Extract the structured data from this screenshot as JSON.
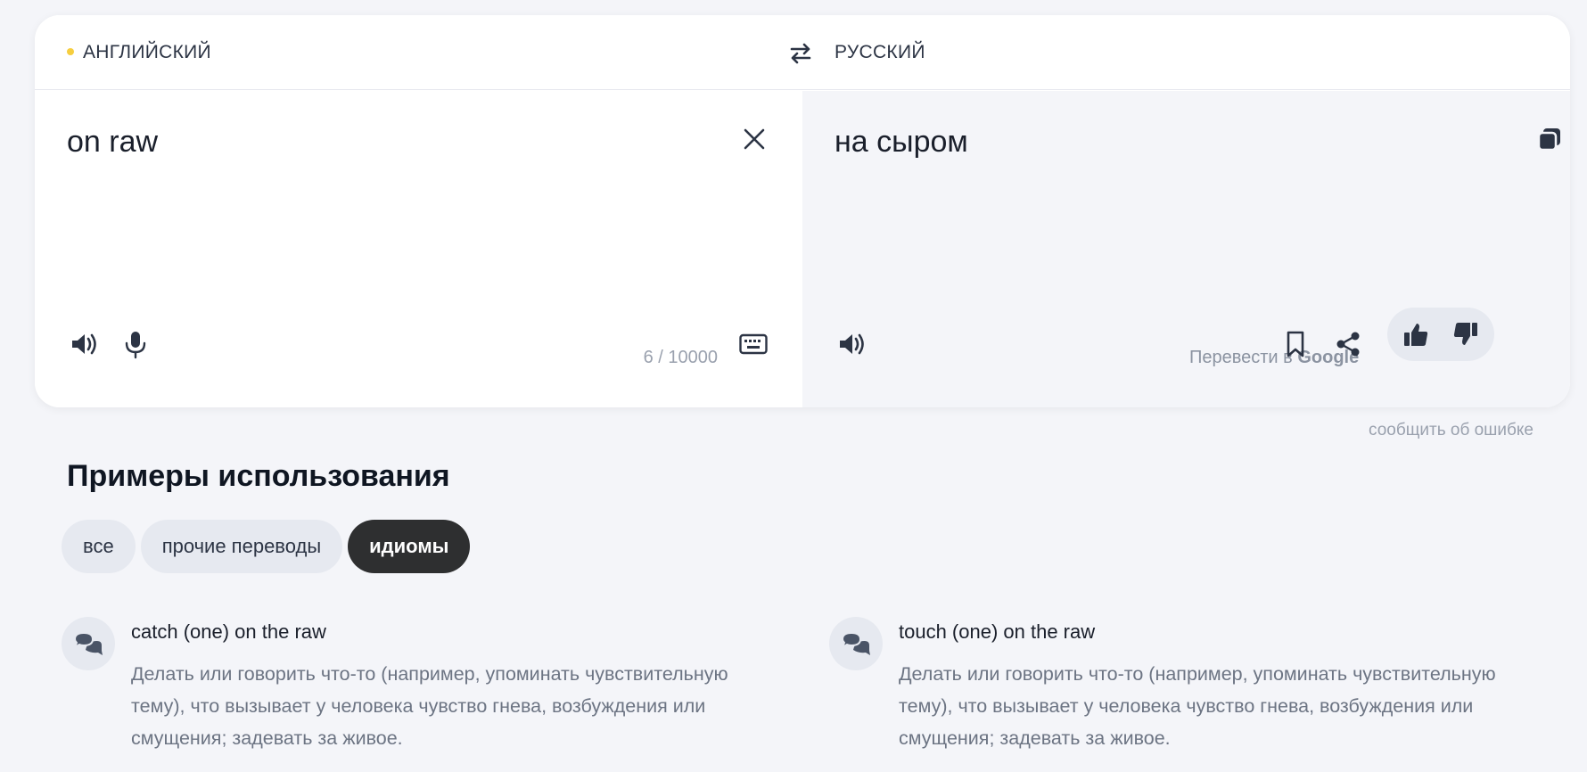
{
  "header": {
    "source_lang": "АНГЛИЙСКИЙ",
    "target_lang": "РУССКИЙ"
  },
  "source": {
    "text": "on raw",
    "counter": "6 / 10000"
  },
  "target": {
    "text": "на сыром",
    "google_prefix": "Перевести в",
    "google_brand": "Google"
  },
  "report_error": "сообщить об ошибке",
  "examples_section": {
    "title": "Примеры использования",
    "filters": [
      {
        "label": "все",
        "active": false
      },
      {
        "label": "прочие переводы",
        "active": false
      },
      {
        "label": "идиомы",
        "active": true
      }
    ],
    "items": [
      {
        "phrase": "catch (one) on the raw",
        "description": "Делать или говорить что-то (например, упоминать чувствительную тему), что вызывает у человека чувство гнева, возбуждения или смущения; задевать за живое."
      },
      {
        "phrase": "touch (one) on the raw",
        "description": "Делать или говорить что-то (например, упоминать чувствительную тему), что вызывает у человека чувство гнева, возбуждения или смущения; задевать за живое."
      }
    ]
  },
  "colors": {
    "accent_dot": "#f6ce3f",
    "active_chip": "#2e2f30",
    "icon": "#2c3444"
  },
  "icons": [
    "swap-icon",
    "close-icon",
    "speaker-icon",
    "microphone-icon",
    "keyboard-icon",
    "copy-icon",
    "bookmark-icon",
    "share-icon",
    "thumbs-up-icon",
    "thumbs-down-icon",
    "chat-icon"
  ]
}
